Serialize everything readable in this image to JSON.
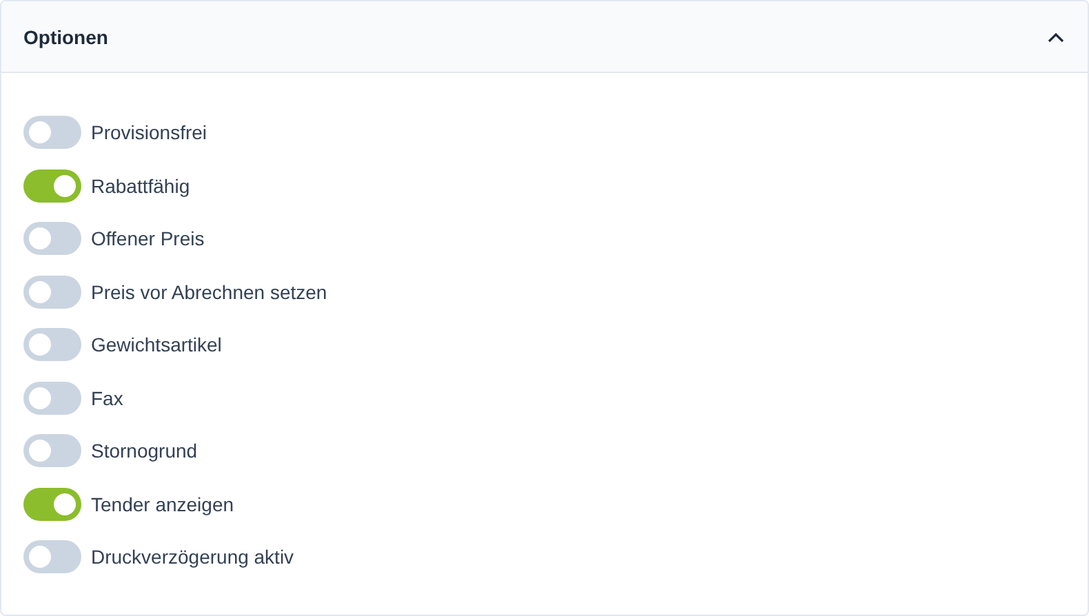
{
  "panel": {
    "title": "Optionen",
    "expanded": true
  },
  "options": [
    {
      "label": "Provisionsfrei",
      "on": false
    },
    {
      "label": "Rabattfähig",
      "on": true
    },
    {
      "label": "Offener Preis",
      "on": false
    },
    {
      "label": "Preis vor Abrechnen setzen",
      "on": false
    },
    {
      "label": "Gewichtsartikel",
      "on": false
    },
    {
      "label": "Fax",
      "on": false
    },
    {
      "label": "Stornogrund",
      "on": false
    },
    {
      "label": "Tender anzeigen",
      "on": true
    },
    {
      "label": "Druckverzögerung aktiv",
      "on": false
    }
  ]
}
